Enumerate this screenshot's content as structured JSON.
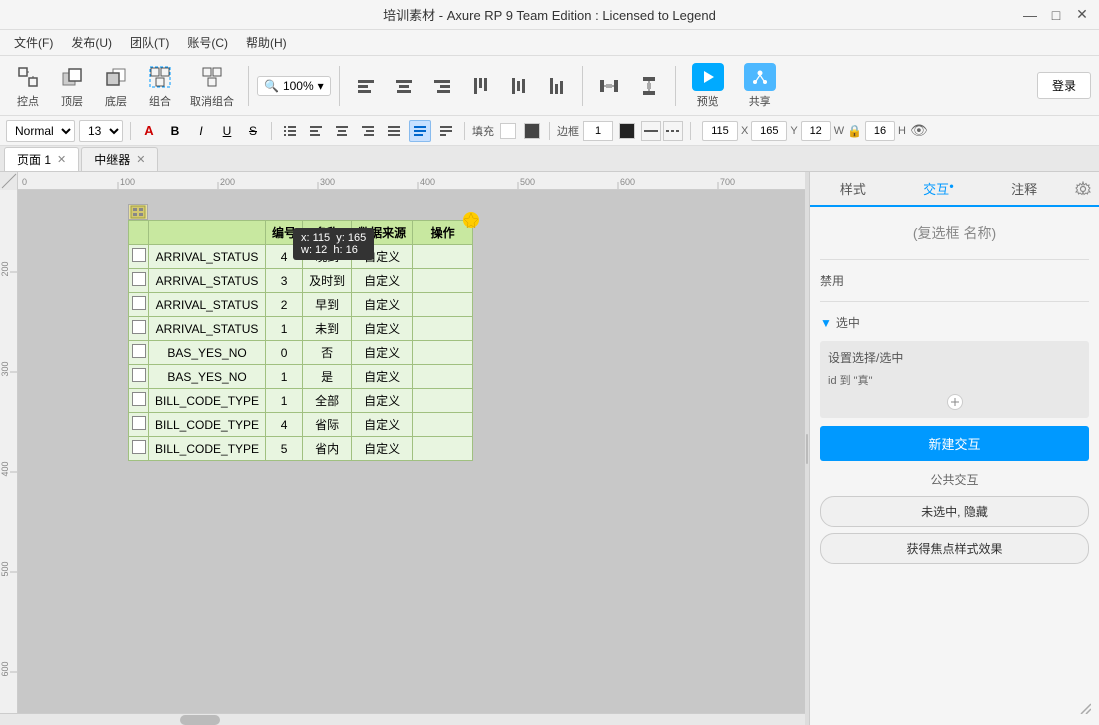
{
  "window": {
    "title": "培训素材 - Axure RP 9 Team Edition : Licensed to Legend",
    "controls": [
      "—",
      "□",
      "✕"
    ]
  },
  "menubar": {
    "items": [
      {
        "label": "文件(F)"
      },
      {
        "label": "发布(U)"
      },
      {
        "label": "团队(T)"
      },
      {
        "label": "账号(C)"
      },
      {
        "label": "帮助(H)"
      }
    ]
  },
  "toolbar": {
    "items": [
      {
        "icon": "⊕",
        "label": "控点"
      },
      {
        "icon": "▣",
        "label": "顶层"
      },
      {
        "icon": "▤",
        "label": "底层"
      },
      {
        "icon": "⊞",
        "label": "组合"
      },
      {
        "icon": "⊟",
        "label": "取消组合"
      },
      {
        "zoom": "100%"
      },
      {
        "icon": "◧",
        "label": "左"
      },
      {
        "icon": "◨",
        "label": "居中"
      },
      {
        "icon": "◩",
        "label": "右"
      },
      {
        "icon": "⬒",
        "label": "顶部"
      },
      {
        "icon": "⬓",
        "label": "层中"
      },
      {
        "icon": "▭",
        "label": "底部形"
      },
      {
        "icon": "◫",
        "label": "横间"
      },
      {
        "icon": "⬕",
        "label": "重叠"
      }
    ],
    "preview_label": "预览",
    "share_label": "共享",
    "login_label": "登录"
  },
  "formatbar": {
    "style_select": "Normal",
    "font_size": "13",
    "text_color_label": "A",
    "bold": "B",
    "italic": "I",
    "underline": "U",
    "strikethrough": "S",
    "list": "≡",
    "align_left": "≡",
    "align_center": "≡",
    "align_right": "≡",
    "align_justify": "≡",
    "fill_label": "填充",
    "border_label": "边框",
    "border_val": "1",
    "x_label": "X",
    "x_val": "115",
    "y_label": "Y",
    "y_val": "165",
    "w_label": "W",
    "w_val": "12",
    "h_label": "H",
    "h_val": "16"
  },
  "tabs": [
    {
      "label": "页面 1",
      "closable": true
    },
    {
      "label": "中继器",
      "closable": true
    }
  ],
  "canvas": {
    "ruler_ticks": [
      "0",
      "100",
      "200",
      "300",
      "400",
      "500",
      "600",
      "700"
    ],
    "vticks": [
      "200",
      "300",
      "400",
      "500",
      "600"
    ]
  },
  "widget_tooltip": {
    "x": "x: 115",
    "y": "y: 165",
    "w": "w: 12",
    "h": "h: 16"
  },
  "table": {
    "headers": [
      "",
      "编号",
      "名称",
      "数据来源",
      "操作"
    ],
    "rows": [
      {
        "checkbox": false,
        "id": "ARRIVAL_STATUS",
        "code": "4",
        "name": "晚到",
        "source": "自定义",
        "action": ""
      },
      {
        "checkbox": false,
        "id": "ARRIVAL_STATUS",
        "code": "3",
        "name": "及时到",
        "source": "自定义",
        "action": ""
      },
      {
        "checkbox": false,
        "id": "ARRIVAL_STATUS",
        "code": "2",
        "name": "早到",
        "source": "自定义",
        "action": ""
      },
      {
        "checkbox": false,
        "id": "ARRIVAL_STATUS",
        "code": "1",
        "name": "未到",
        "source": "自定义",
        "action": ""
      },
      {
        "checkbox": false,
        "id": "BAS_YES_NO",
        "code": "0",
        "name": "否",
        "source": "自定义",
        "action": ""
      },
      {
        "checkbox": false,
        "id": "BAS_YES_NO",
        "code": "1",
        "name": "是",
        "source": "自定义",
        "action": ""
      },
      {
        "checkbox": false,
        "id": "BILL_CODE_TYPE",
        "code": "1",
        "name": "全部",
        "source": "自定义",
        "action": ""
      },
      {
        "checkbox": false,
        "id": "BILL_CODE_TYPE",
        "code": "4",
        "name": "省际",
        "source": "自定义",
        "action": ""
      },
      {
        "checkbox": false,
        "id": "BILL_CODE_TYPE",
        "code": "5",
        "name": "省内",
        "source": "自定义",
        "action": ""
      }
    ]
  },
  "right_panel": {
    "tabs": [
      {
        "label": "样式",
        "active": false
      },
      {
        "label": "交互",
        "active": true,
        "dot": true
      },
      {
        "label": "注释",
        "active": false
      }
    ],
    "placeholder_title": "(复选框 名称)",
    "disable_label": "禁用",
    "selected_section": "选中",
    "interaction_label": "设置选择/选中",
    "interaction_desc": "id 到 \"真\"",
    "new_btn_label": "新建交互",
    "public_label": "公共交互",
    "public_btn1": "未选中, 隐藏",
    "public_btn2": "获得焦点样式效果"
  }
}
